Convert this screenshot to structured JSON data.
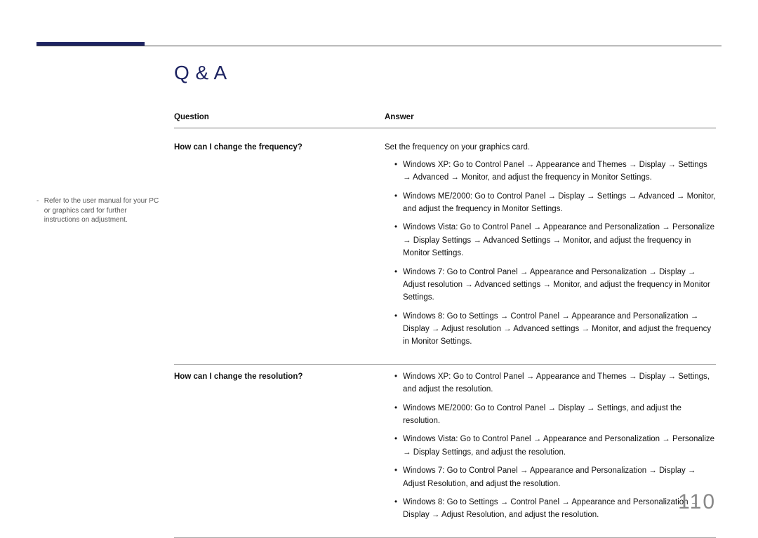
{
  "page_number": "110",
  "title": "Q & A",
  "sidenote": "Refer to the user manual for your PC or graphics card for further instructions on adjustment.",
  "headers": {
    "q": "Question",
    "a": "Answer"
  },
  "rows": [
    {
      "question": "How can I change the frequency?",
      "intro": "Set the frequency on your graphics card.",
      "items": [
        "Windows XP: Go to Control Panel → Appearance and Themes → Display → Settings → Advanced → Monitor, and adjust the frequency in Monitor Settings.",
        "Windows ME/2000: Go to Control Panel → Display → Settings → Advanced → Monitor, and adjust the frequency in Monitor Settings.",
        "Windows Vista: Go to Control Panel → Appearance and Personalization → Personalize → Display Settings → Advanced Settings → Monitor, and adjust the frequency in Monitor Settings.",
        "Windows 7: Go to Control Panel → Appearance and Personalization → Display → Adjust resolution → Advanced settings → Monitor, and adjust the frequency in Monitor Settings.",
        "Windows 8: Go to Settings → Control Panel → Appearance and Personalization → Display → Adjust resolution → Advanced settings → Monitor, and adjust the frequency in Monitor Settings."
      ]
    },
    {
      "question": "How can I change the resolution?",
      "intro": "",
      "items": [
        "Windows XP: Go to Control Panel → Appearance and Themes → Display → Settings, and adjust the resolution.",
        "Windows ME/2000: Go to Control Panel → Display → Settings, and adjust the resolution.",
        "Windows Vista: Go to Control Panel → Appearance and Personalization → Personalize → Display Settings, and adjust the resolution.",
        "Windows 7: Go to Control Panel → Appearance and Personalization → Display → Adjust Resolution, and adjust the resolution.",
        "Windows 8: Go to Settings → Control Panel → Appearance and Personalization → Display → Adjust Resolution, and adjust the resolution."
      ]
    }
  ]
}
